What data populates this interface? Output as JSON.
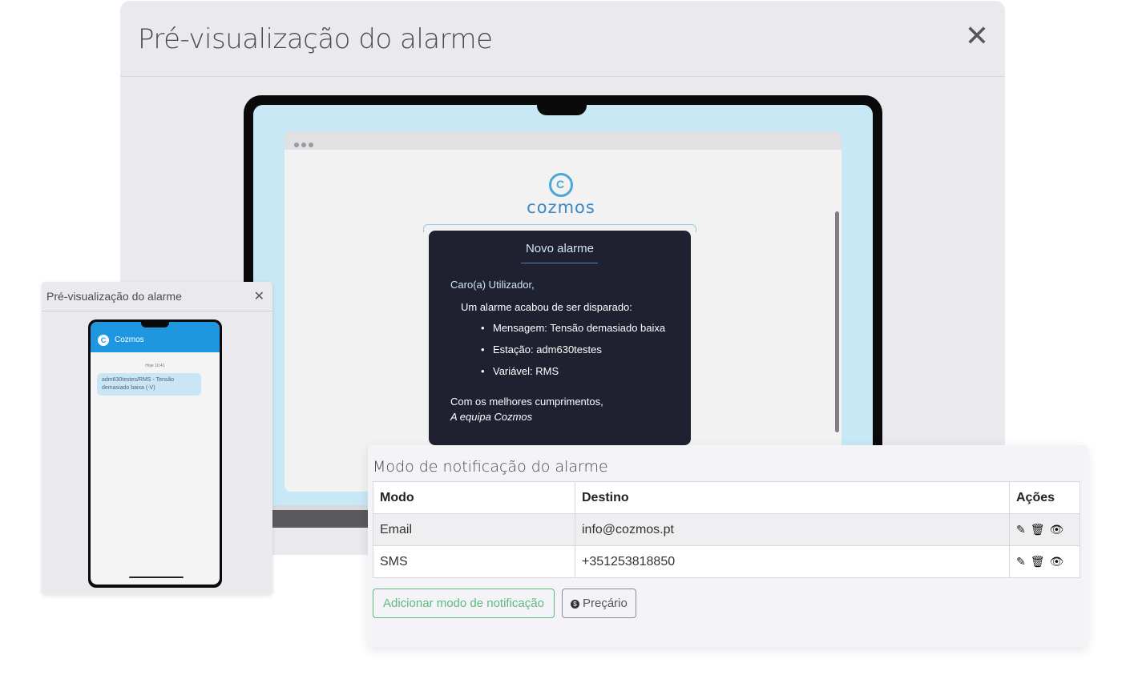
{
  "preview_modal": {
    "title": "Pré-visualização do alarme",
    "close": "✕"
  },
  "email_preview": {
    "logo_mark": "C",
    "logo_word": "cozmos",
    "heading": "Novo alarme",
    "greeting": "Caro(a) Utilizador,",
    "intro": "Um alarme acabou de ser disparado:",
    "items": [
      "Mensagem: Tensão demasiado baixa",
      "Estação: adm630testes",
      "Variável: RMS"
    ],
    "closing": "Com os melhores cumprimentos,",
    "signature": "A equipa Cozmos"
  },
  "sms_modal": {
    "title": "Pré-visualização do alarme",
    "close": "✕",
    "contact": "Cozmos",
    "avatar": "C",
    "timestamp": "Hoje 10:41",
    "message": "adm630testes/RMS - Tensão demasiado baixa (-V)"
  },
  "notification_panel": {
    "title": "Modo de notificação do alarme",
    "columns": [
      "Modo",
      "Destino",
      "Ações"
    ],
    "rows": [
      {
        "mode": "Email",
        "destination": "info@cozmos.pt"
      },
      {
        "mode": "SMS",
        "destination": "+351253818850"
      }
    ],
    "add_button": "Adicionar modo de notificação",
    "price_button": "Preçário",
    "price_icon": "$"
  },
  "icons": {
    "edit": "pencil-icon",
    "delete": "trash-icon",
    "view": "eye-icon"
  },
  "colors": {
    "accent_blue": "#1e97e0",
    "success_green": "#5dba7e",
    "email_card": "#1f2030"
  }
}
